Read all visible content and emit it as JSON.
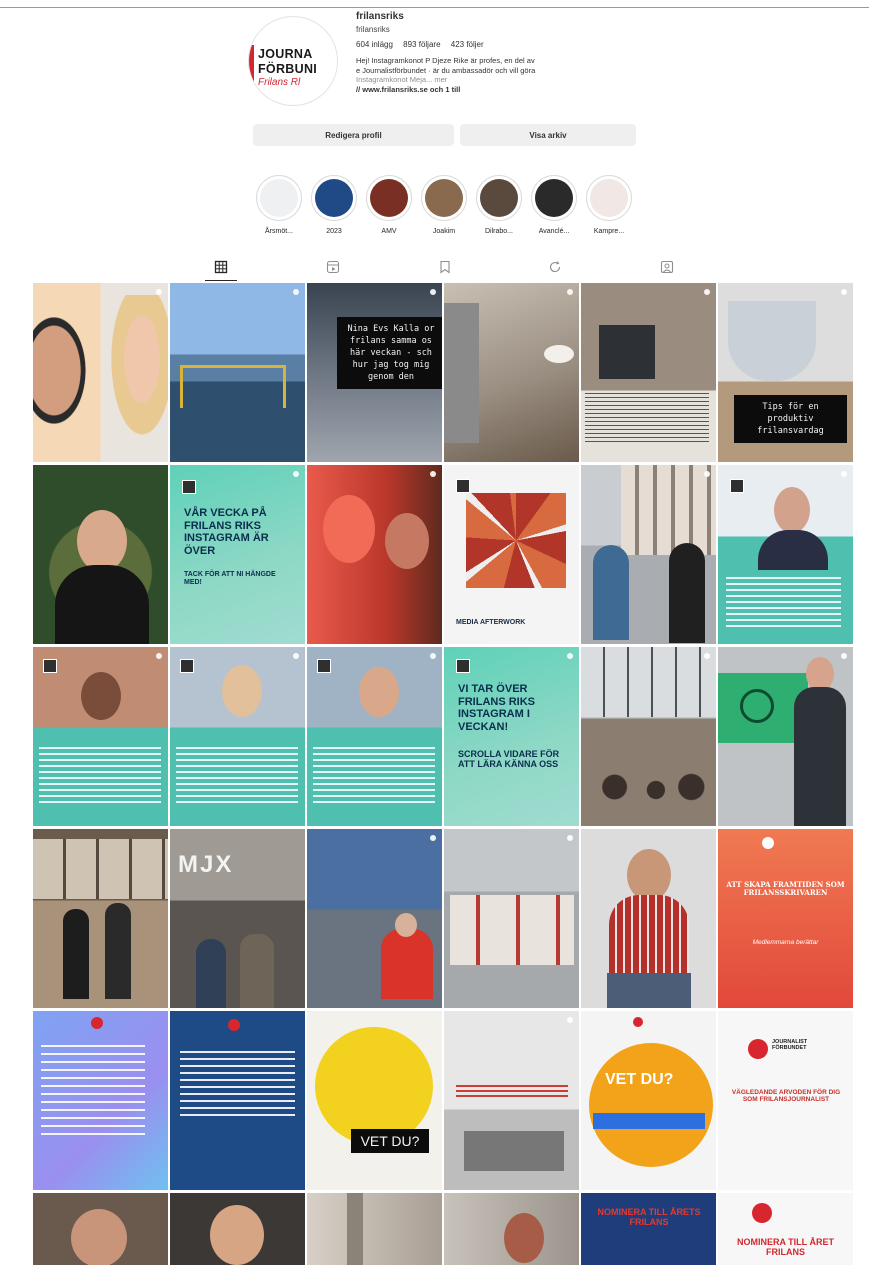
{
  "profile": {
    "username": "frilansriks",
    "full_name": "frilansriks",
    "avatar_line1": "JOURNA",
    "avatar_line2": "FÖRBUNI",
    "avatar_line3": "Frilans Rl",
    "stats": {
      "posts": "604 inlägg",
      "followers": "893 följare",
      "following": "423 följer"
    },
    "bio_line1": "Hej! Instagramkonot P Djeze Rike är profes, en del av",
    "bio_line2": "e Journalistförbundet · är du ambassadör och vill göra",
    "bio_line3": "Instagramkonot Meja... mer",
    "bio_line4": "// www.frilansriks.se och 1 till",
    "edit_button": "Redigera profil",
    "archive_button": "Visa arkiv"
  },
  "highlights": [
    {
      "label": "Årsmöt..."
    },
    {
      "label": "2023"
    },
    {
      "label": "AMV"
    },
    {
      "label": "Joakim"
    },
    {
      "label": "Dilrabo..."
    },
    {
      "label": "Avanclé..."
    },
    {
      "label": "Kampre..."
    }
  ],
  "tabs": [
    {
      "name": "posts",
      "active": true
    },
    {
      "name": "reels",
      "active": false
    },
    {
      "name": "saved",
      "active": false
    },
    {
      "name": "tagged",
      "active": false
    },
    {
      "name": "tagged2",
      "active": false
    }
  ],
  "tiles": {
    "t3": "Nina Evs Kalla or frilans samma os här veckan - sch hur jag tog mig genom den",
    "t6": "Tips för en produktiv frilansvardag",
    "t8": "VÅR VECKA PÅ FRILANS RIKS INSTAGRAM ÄR ÖVER",
    "t8b": "TACK FÖR ATT NI HÄNGDE MED!",
    "t11": "MEDIA AFTERWORK",
    "t16": "VI TAR ÖVER FRILANS RIKS INSTAGRAM I VECKAN!",
    "t16b": "SCROLLA VIDARE FÖR ATT LÄRA KÄNNA OSS",
    "t20": "MJX",
    "t24": "ATT SKAPA FRAMTIDEN SOM FRILANSSKRIVAREN",
    "t24b": "Medlemmarna berättar",
    "t27": "VET DU?",
    "t29": "VET DU?",
    "t30": "JOURNALIST FÖRBUNDET",
    "t30b": "VÄGLEDANDE ARVODEN FÖR DIG SOM FRILANSJOURNALIST",
    "t35": "NOMINERA TILL ÅRETS FRILANS",
    "t36": "NOMINERA TILL ÅRET FRILANS"
  }
}
